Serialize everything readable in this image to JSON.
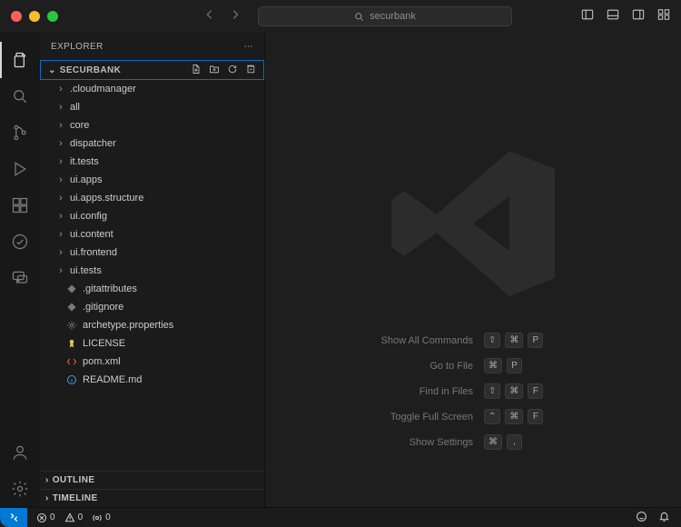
{
  "titlebar": {
    "search_placeholder": "securbank"
  },
  "explorer": {
    "title": "EXPLORER",
    "project_name": "SECURBANK",
    "outline": "OUTLINE",
    "timeline": "TIMELINE"
  },
  "tree": {
    "folders": [
      ".cloudmanager",
      "all",
      "core",
      "dispatcher",
      "it.tests",
      "ui.apps",
      "ui.apps.structure",
      "ui.config",
      "ui.content",
      "ui.frontend",
      "ui.tests"
    ],
    "files": [
      {
        "name": ".gitattributes",
        "kind": "diamond"
      },
      {
        "name": ".gitignore",
        "kind": "diamond"
      },
      {
        "name": "archetype.properties",
        "kind": "gear"
      },
      {
        "name": "LICENSE",
        "kind": "license"
      },
      {
        "name": "pom.xml",
        "kind": "xml"
      },
      {
        "name": "README.md",
        "kind": "info"
      }
    ]
  },
  "hints": [
    {
      "label": "Show All Commands",
      "keys": [
        "⇧",
        "⌘",
        "P"
      ]
    },
    {
      "label": "Go to File",
      "keys": [
        "⌘",
        "P"
      ]
    },
    {
      "label": "Find in Files",
      "keys": [
        "⇧",
        "⌘",
        "F"
      ]
    },
    {
      "label": "Toggle Full Screen",
      "keys": [
        "⌃",
        "⌘",
        "F"
      ]
    },
    {
      "label": "Show Settings",
      "keys": [
        "⌘",
        ","
      ]
    }
  ],
  "status": {
    "errors": "0",
    "warnings": "0",
    "ports": "0"
  }
}
